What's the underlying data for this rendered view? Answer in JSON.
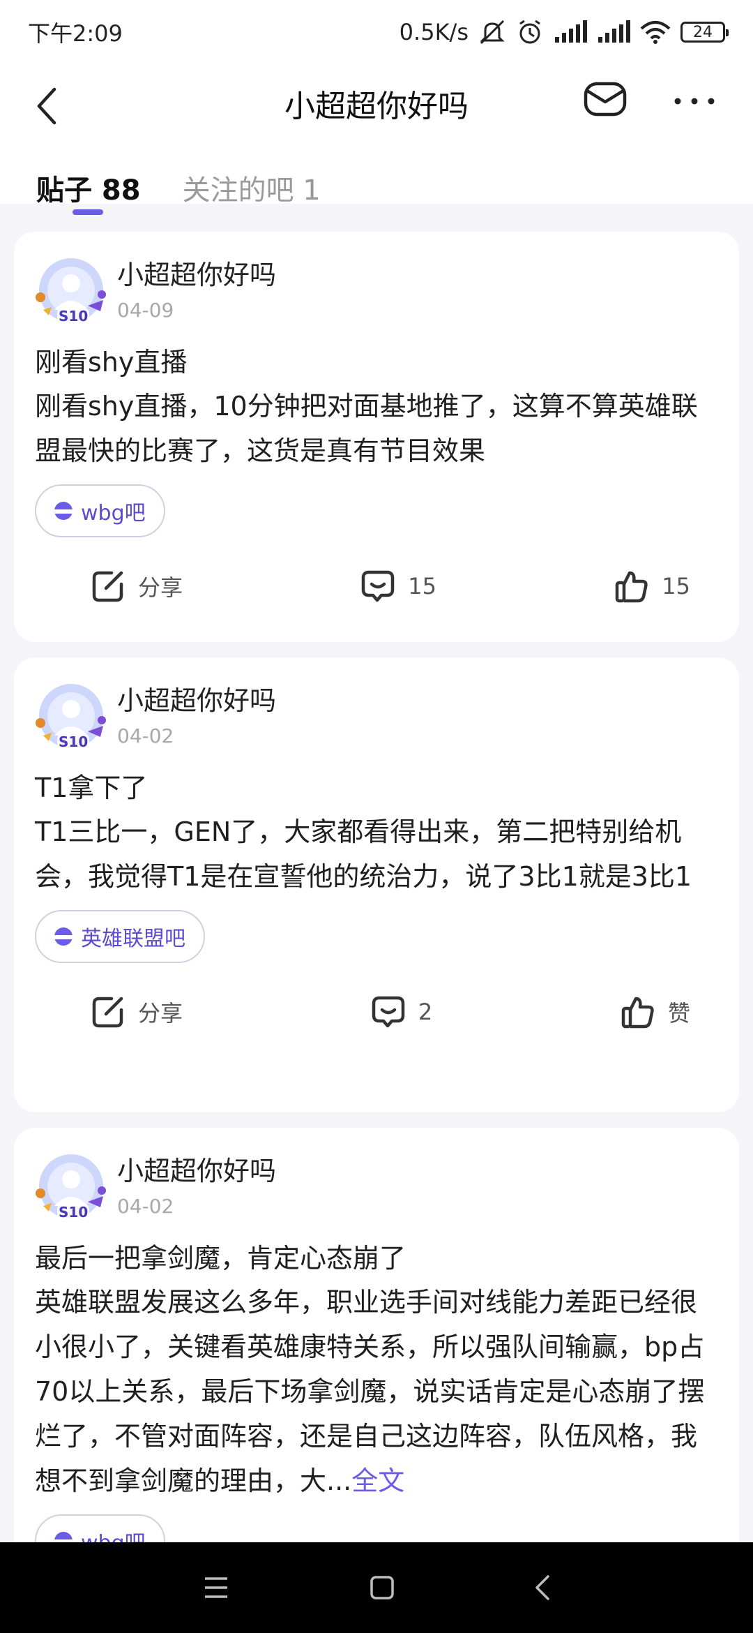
{
  "status_bar": {
    "time": "下午2:09",
    "speed": "0.5K/s",
    "battery": "24"
  },
  "header": {
    "title": "小超超你好吗"
  },
  "tabs": [
    {
      "label": "贴子 88",
      "active": true
    },
    {
      "label": "关注的吧 1",
      "active": false
    }
  ],
  "posts": [
    {
      "author": "小超超你好吗",
      "avatar_badge": "S10",
      "date": "04-09",
      "title": "刚看shy直播",
      "body": "刚看shy直播，10分钟把对面基地推了，这算不算英雄联盟最快的比赛了，这货是真有节目效果",
      "tag": "wbg吧",
      "share_label": "分享",
      "comment_count": "15",
      "like_label": "15"
    },
    {
      "author": "小超超你好吗",
      "avatar_badge": "S10",
      "date": "04-02",
      "title": "T1拿下了",
      "body": "T1三比一，GEN了，大家都看得出来，第二把特别给机会，我觉得T1是在宣誓他的统治力，说了3比1就是3比1",
      "tag": "英雄联盟吧",
      "share_label": "分享",
      "comment_count": "2",
      "like_label": "赞"
    },
    {
      "author": "小超超你好吗",
      "avatar_badge": "S10",
      "date": "04-02",
      "title": "最后一把拿剑魔，肯定心态崩了",
      "body": "英雄联盟发展这么多年，职业选手间对线能力差距已经很小很小了，关键看英雄康特关系，所以强队间输赢，bp占70以上关系，最后下场拿剑魔，说实话肯定是心态崩了摆烂了，不管对面阵容，还是自己这边阵容，队伍风格，我想不到拿剑魔的理由，大...",
      "more_label": "全文",
      "tag": "wbg吧"
    }
  ],
  "colors": {
    "accent": "#6b5ce7",
    "background": "#f5f4f8",
    "card": "#ffffff"
  }
}
